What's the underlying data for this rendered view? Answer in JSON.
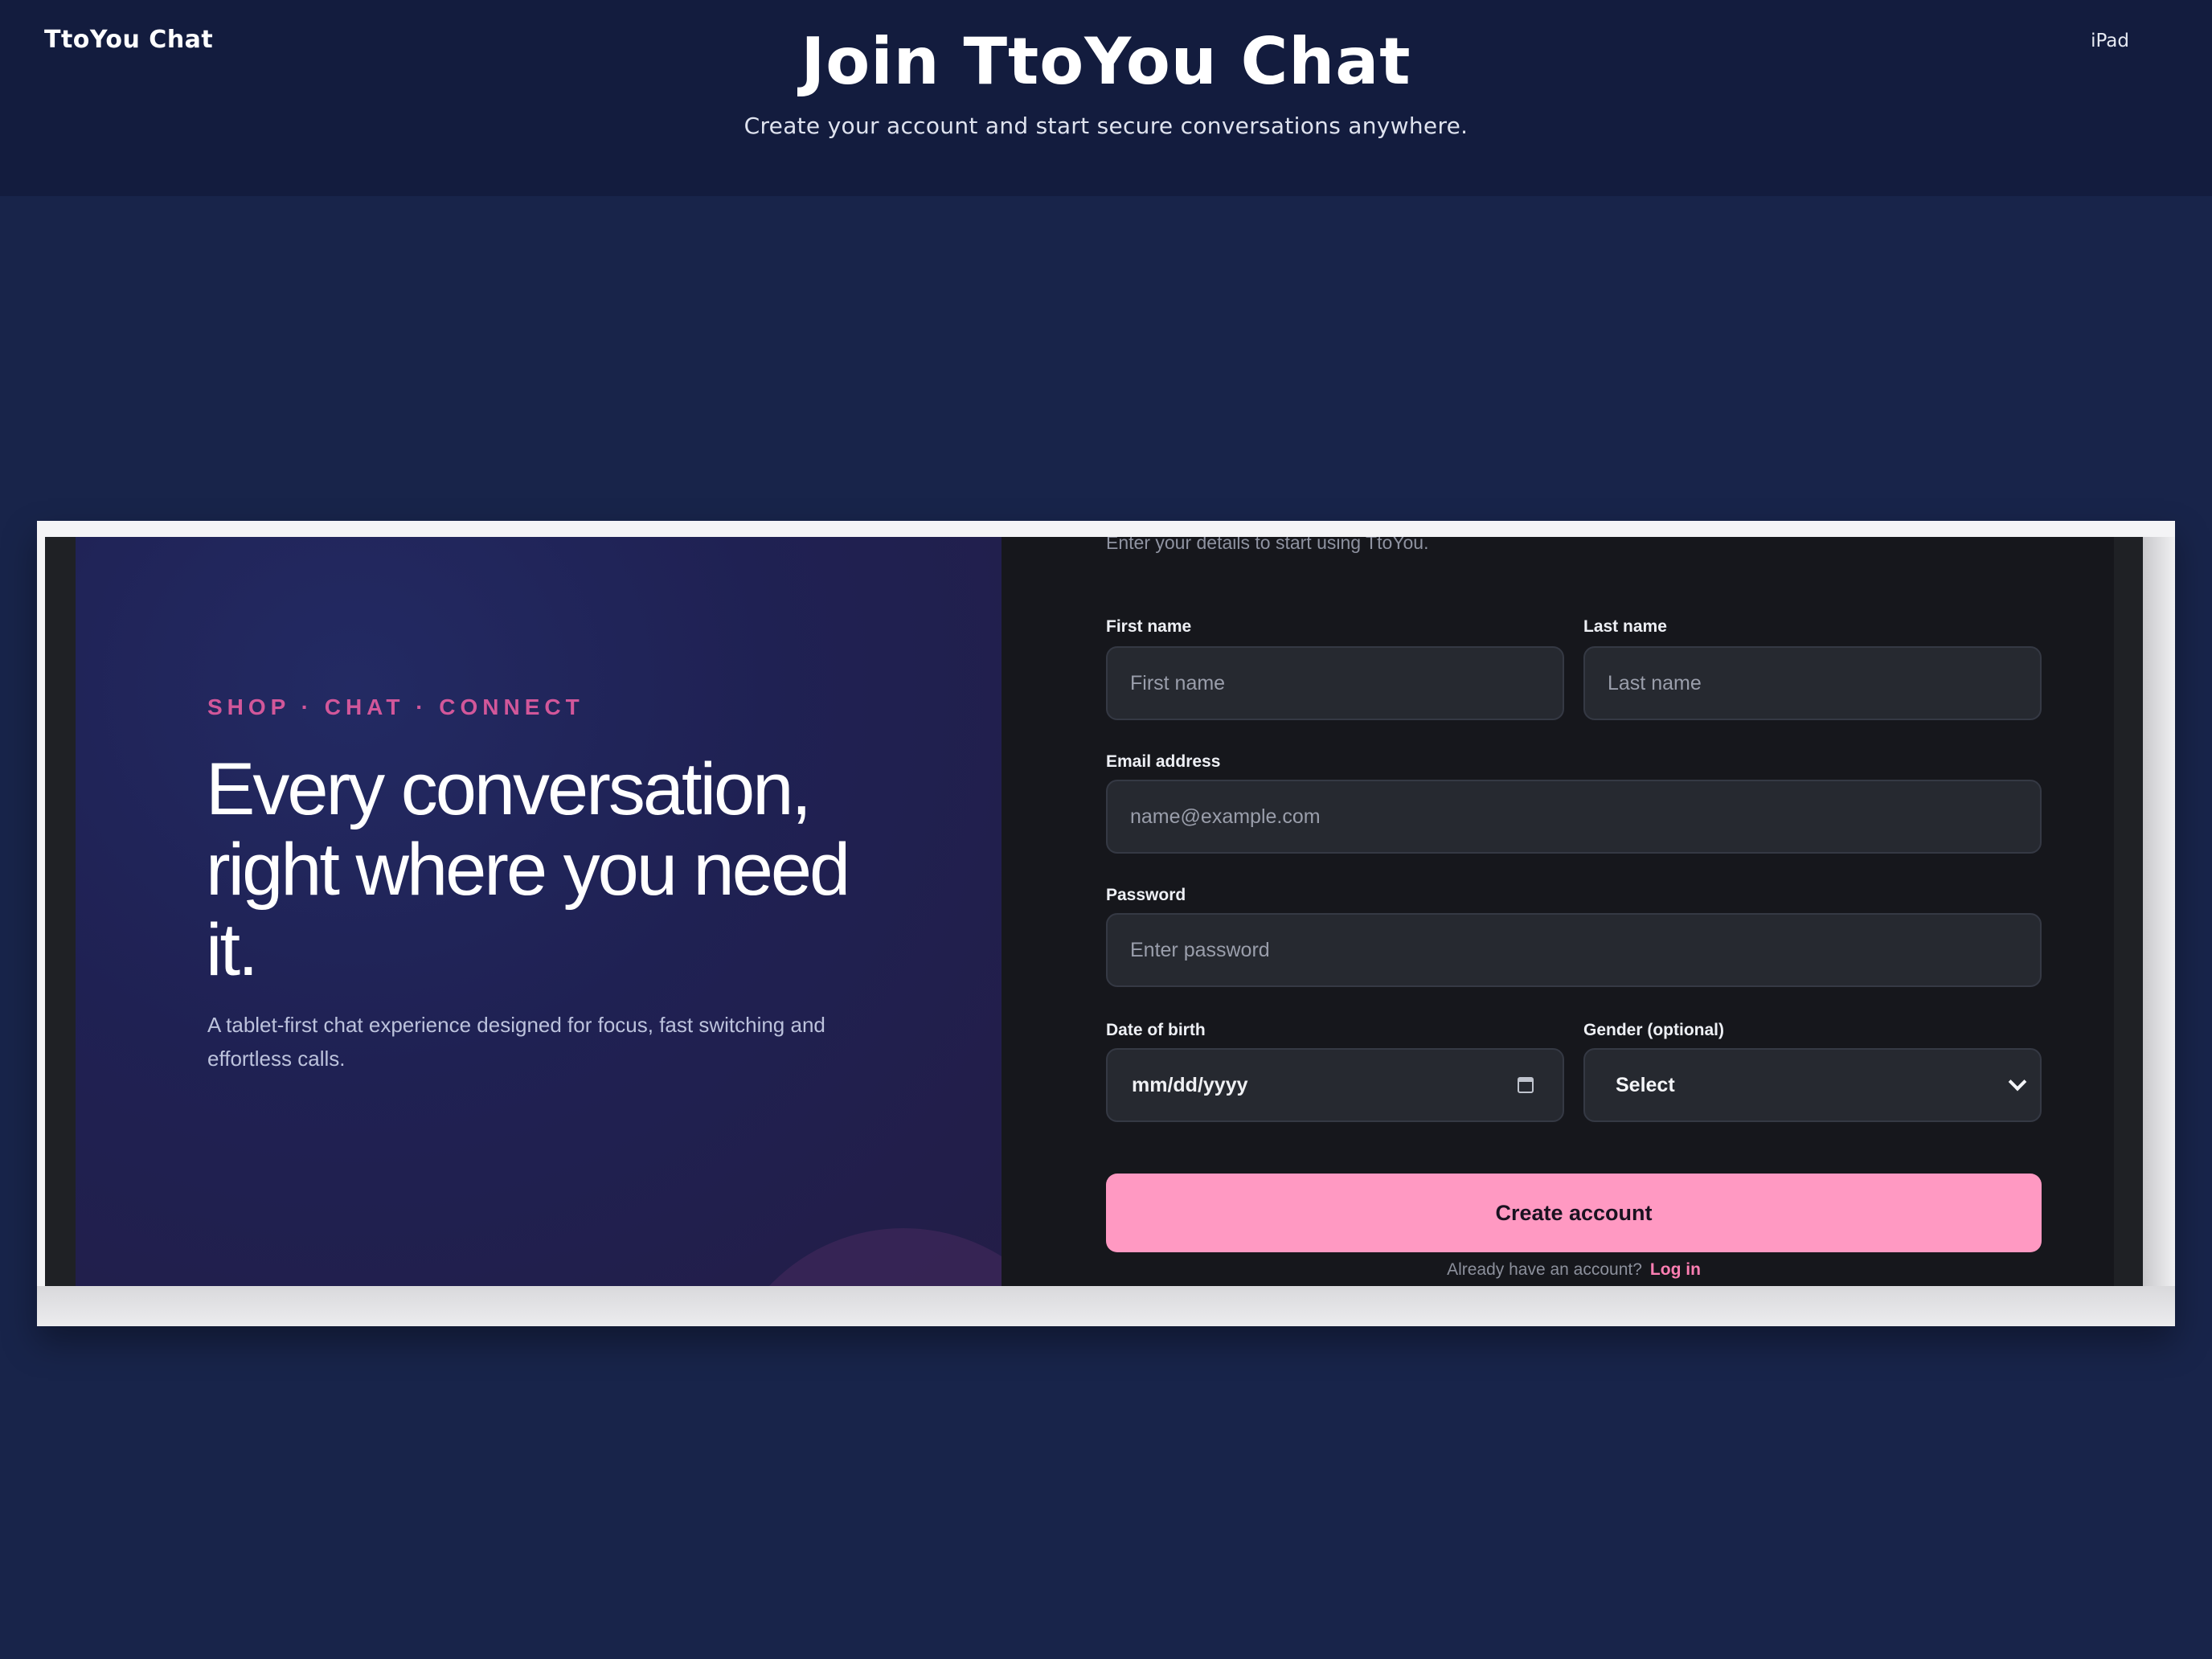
{
  "header": {
    "brand": "TtoYou Chat",
    "title": "Join TtoYou Chat",
    "subtitle": "Create your account and start secure conversations anywhere.",
    "device_label": "iPad"
  },
  "hero": {
    "eyebrow": "SHOP · CHAT · CONNECT",
    "headline": "Every conversation, right where you need it.",
    "body": "A tablet-first chat experience designed for focus, fast switching and effortless calls."
  },
  "form": {
    "intro": "Enter your details to start using TtoYou.",
    "first_name": {
      "label": "First name",
      "placeholder": "First name",
      "value": ""
    },
    "last_name": {
      "label": "Last name",
      "placeholder": "Last name",
      "value": ""
    },
    "email": {
      "label": "Email address",
      "placeholder": "name@example.com",
      "value": ""
    },
    "password": {
      "label": "Password",
      "placeholder": "Enter password",
      "value": ""
    },
    "dob": {
      "label": "Date of birth",
      "value": "mm/dd/yyyy",
      "icon": "calendar-icon"
    },
    "gender": {
      "label": "Gender (optional)",
      "selected": "Select",
      "icon": "chevron-down-icon"
    },
    "submit_label": "Create account",
    "login_prompt": "Already have an account?",
    "login_link": "Log in"
  },
  "colors": {
    "page_background": "#18244a",
    "header_background": "#131c3e",
    "accent_pink": "#ff99c2",
    "eyebrow_pink": "#d2579a",
    "form_background": "#16171c",
    "field_background": "#262930"
  }
}
